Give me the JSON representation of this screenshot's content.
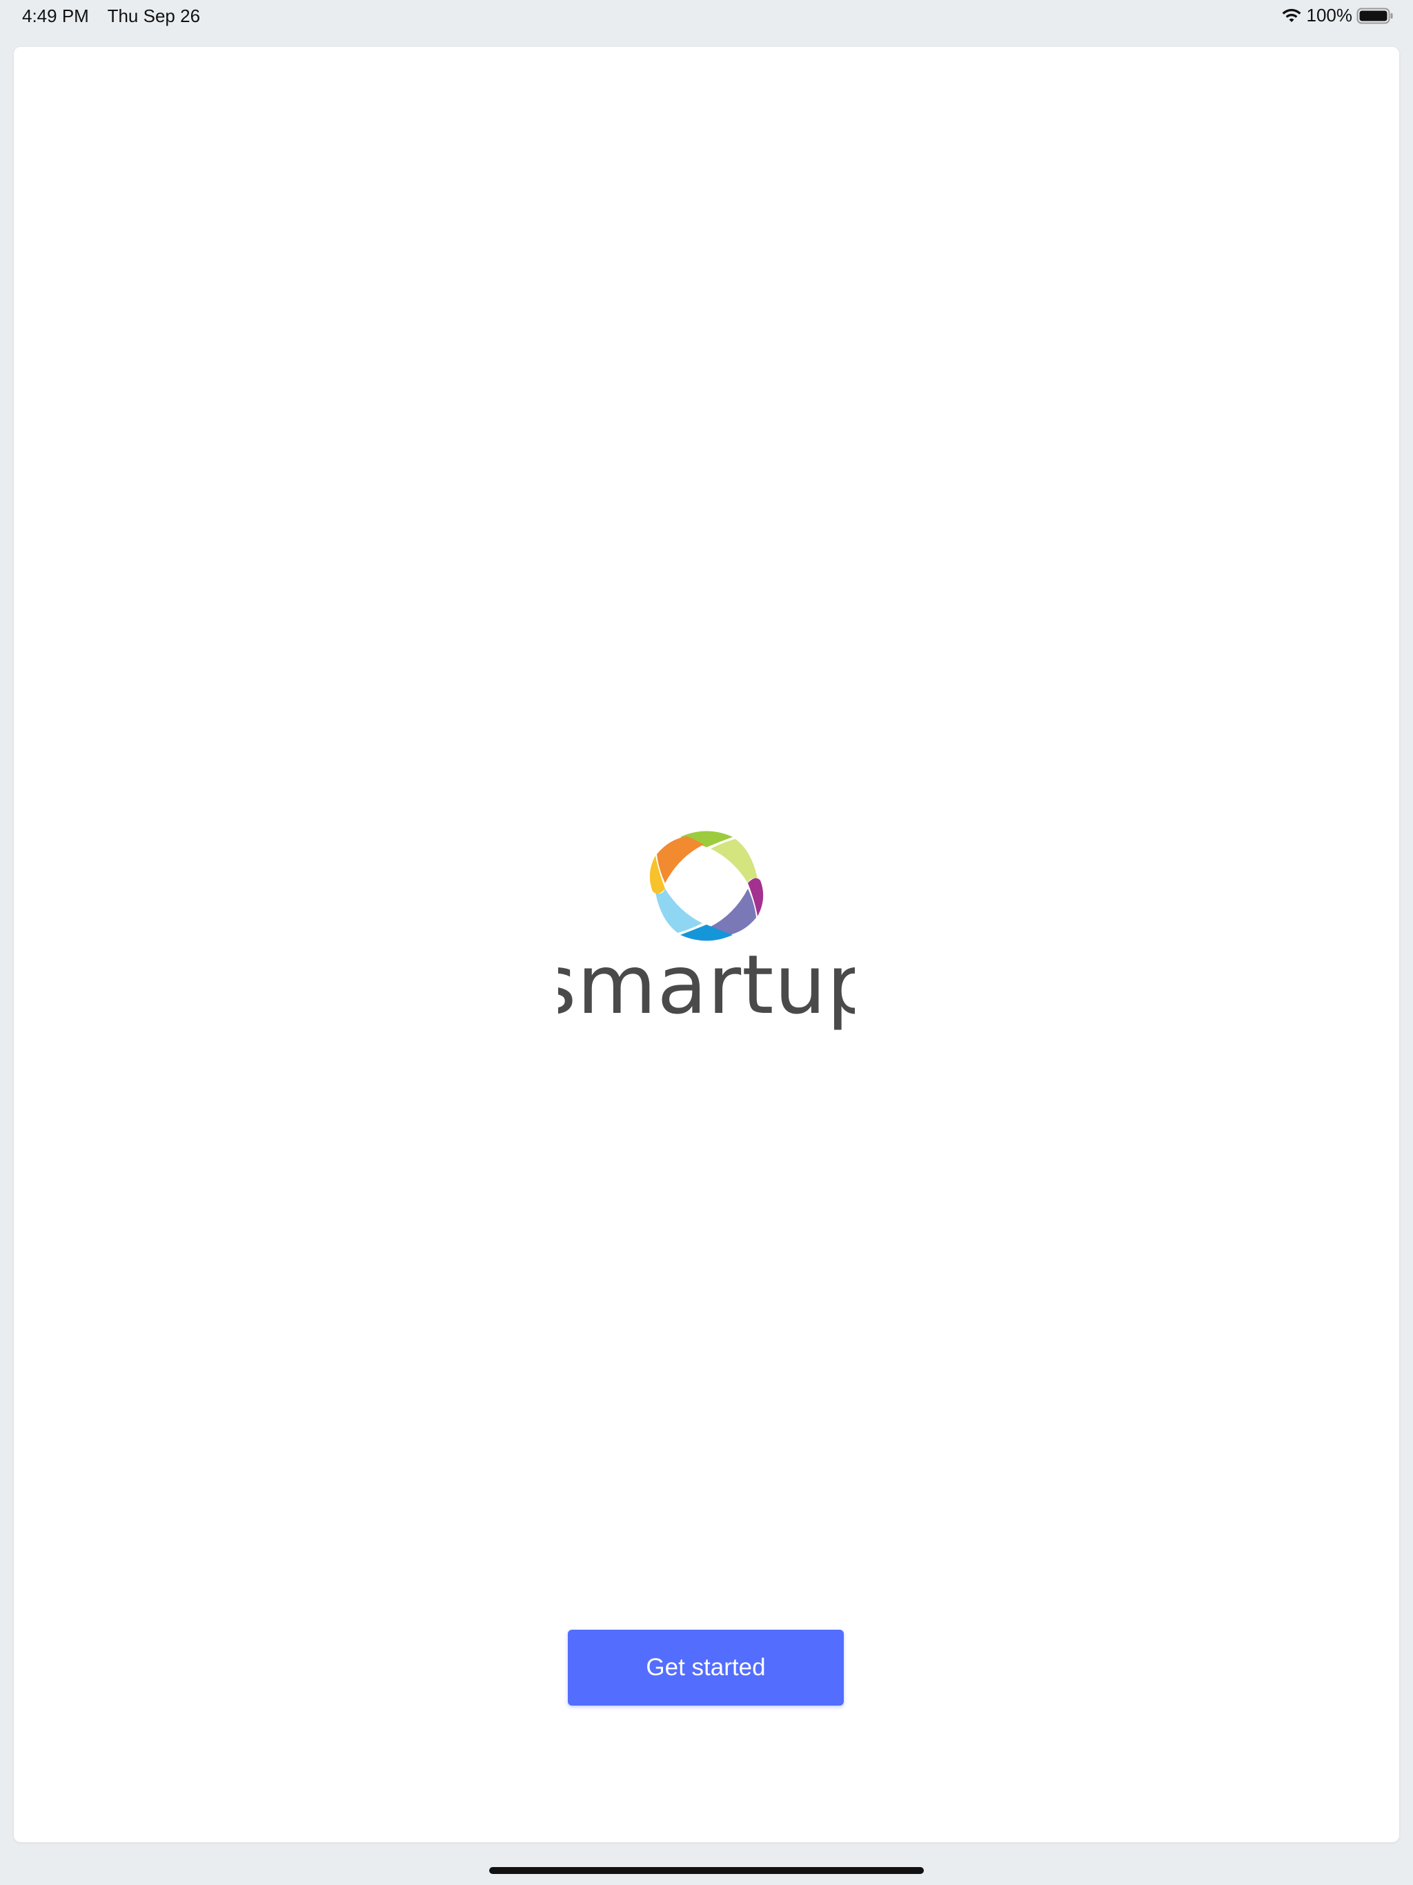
{
  "status_bar": {
    "time": "4:49 PM",
    "date": "Thu Sep 26",
    "battery": "100%",
    "icons": [
      "wifi-icon",
      "battery-icon"
    ]
  },
  "logo": {
    "wordmark": "smartup",
    "colors": {
      "green": "#9ccc3e",
      "light_green": "#d4e47f",
      "orange": "#f28a30",
      "yellow": "#f7c22a",
      "purple": "#a3318f",
      "lavender": "#7b78b8",
      "blue": "#1596d8",
      "light_blue": "#8fd6f2",
      "text": "#4a4a4a"
    }
  },
  "main": {
    "cta_label": "Get started"
  },
  "theme": {
    "accent": "#536dfe",
    "background": "#eaedf0",
    "card": "#ffffff"
  }
}
